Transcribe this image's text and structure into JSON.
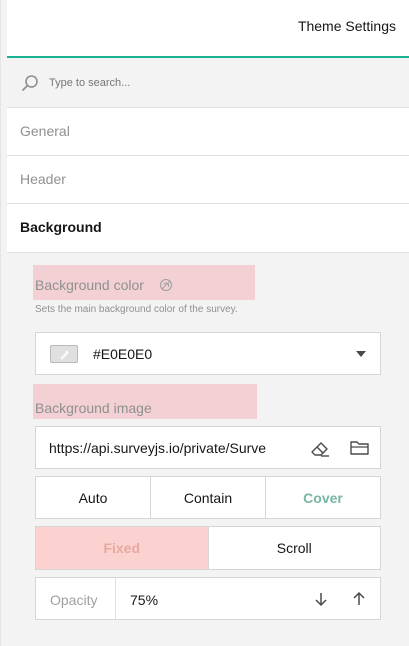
{
  "header": {
    "title": "Theme Settings"
  },
  "search": {
    "placeholder": "Type to search..."
  },
  "sections": {
    "general": "General",
    "header": "Header",
    "background": "Background"
  },
  "background": {
    "color_label": "Background color",
    "color_description": "Sets the main background color of the survey.",
    "color_value": "#E0E0E0",
    "image_label": "Background image",
    "image_url": "https://api.surveyjs.io/private/Surve",
    "fit_options": [
      "Auto",
      "Contain",
      "Cover"
    ],
    "fit_selected": "Cover",
    "attachment_options": [
      "Fixed",
      "Scroll"
    ],
    "attachment_selected": "Fixed",
    "opacity_label": "Opacity",
    "opacity_value": "75%"
  },
  "icons": {
    "search": "search-icon",
    "reset": "reset-icon",
    "eyedropper": "eyedropper-icon",
    "dropdown": "chevron-down-icon",
    "clear": "eraser-icon",
    "browse": "folder-icon",
    "decrease": "arrow-down-icon",
    "increase": "arrow-up-icon"
  },
  "colors": {
    "accent": "#19b394",
    "highlight": "#f2d0d3",
    "selected_fill": "#fbd2d0"
  }
}
